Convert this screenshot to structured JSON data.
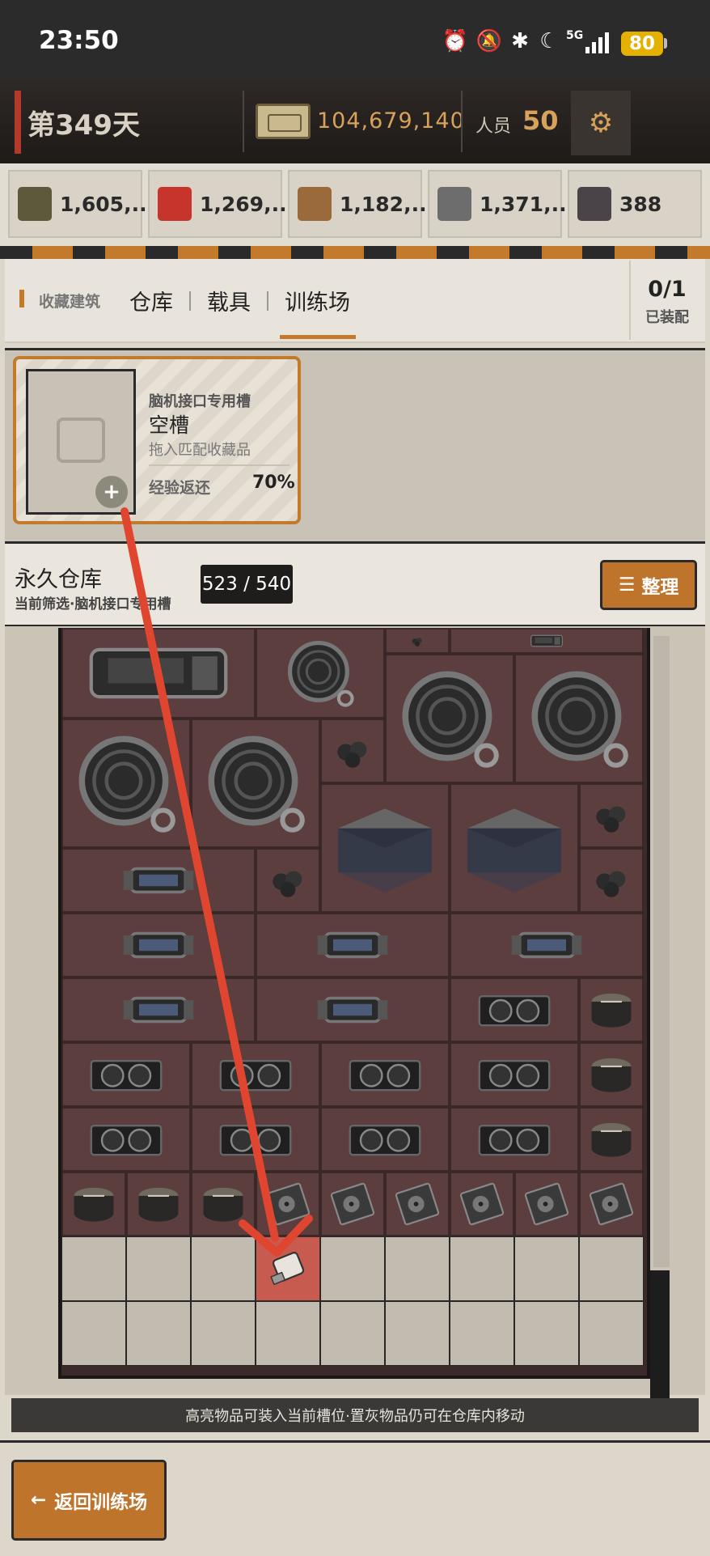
{
  "status_bar": {
    "time": "23:50",
    "network": "5G",
    "battery": "80"
  },
  "header": {
    "day": "第349天",
    "money": "104,679,140",
    "staff_label": "人员",
    "staff_count": "50"
  },
  "resources": [
    {
      "name": "food-icon",
      "value": "1,605,...",
      "color": "#5d5a3c"
    },
    {
      "name": "medkit-icon",
      "value": "1,269,...",
      "color": "#c7342c"
    },
    {
      "name": "wood-icon",
      "value": "1,182,...",
      "color": "#9a6a3a"
    },
    {
      "name": "metal-ingot-icon",
      "value": "1,371,...",
      "color": "#6d6d6d"
    },
    {
      "name": "gear-part-icon",
      "value": "388",
      "color": "#4a4448"
    }
  ],
  "tabs": {
    "section": "收藏建筑",
    "items": [
      "仓库",
      "载具",
      "训练场"
    ],
    "active": "训练场",
    "equip_count": "0/1",
    "equip_label": "已装配"
  },
  "slot": {
    "type": "脑机接口专用槽",
    "name": "空槽",
    "hint": "拖入匹配收藏品",
    "exp_label": "经验返还",
    "exp_value": "70%"
  },
  "warehouse": {
    "title": "永久仓库",
    "subtitle": "当前筛选·脑机接口专用槽",
    "count": "523 / 540",
    "sort_label": "整理"
  },
  "footer_hint": "高亮物品可装入当前槽位·置灰物品仍可在仓库内移动",
  "back_label": "返回训练场",
  "colors": {
    "accent": "#c37a2d",
    "item_bg": "#5d3e3f",
    "highlight": "#c85b4f",
    "arrow": "#e0452f"
  }
}
